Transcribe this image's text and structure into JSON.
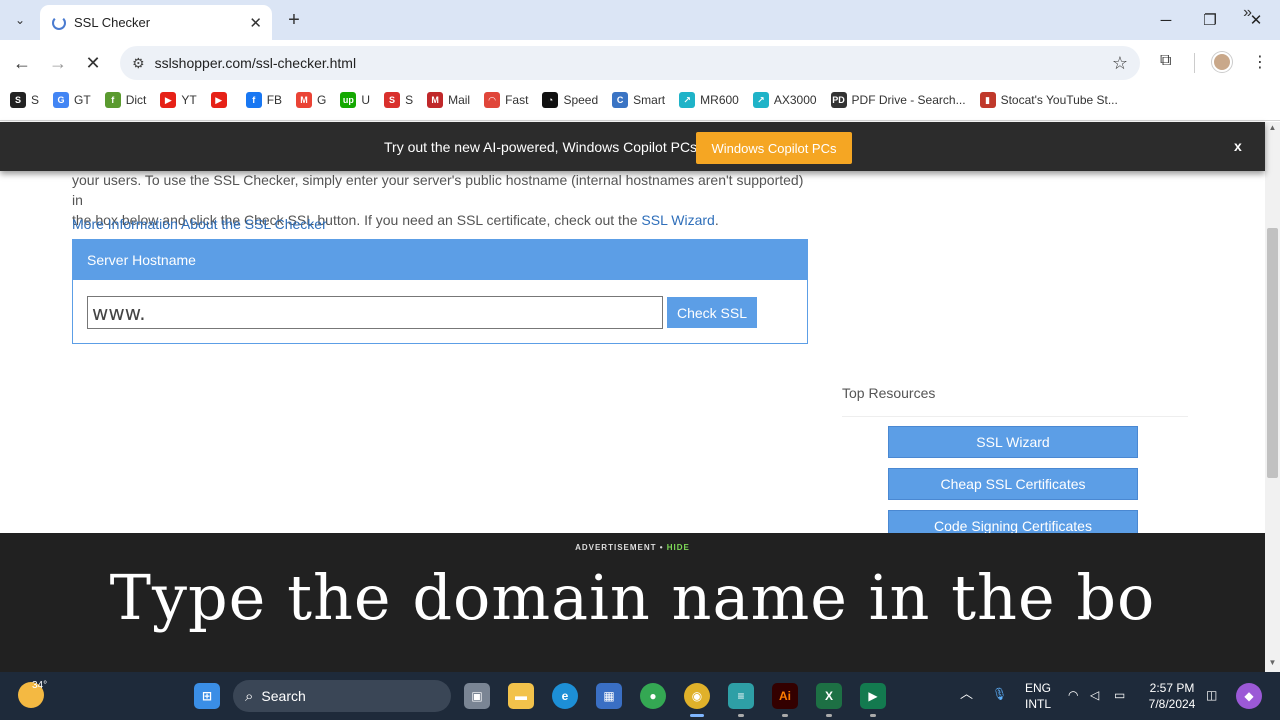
{
  "browser": {
    "tab_title": "SSL Checker",
    "url": "sslshopper.com/ssl-checker.html",
    "new_tab_glyph": "+",
    "close_glyph": "✕"
  },
  "bookmarks": [
    {
      "label": "S",
      "color": "#222222",
      "icon": "S"
    },
    {
      "label": "GT",
      "color": "#4285f4",
      "icon": "G"
    },
    {
      "label": "Dict",
      "color": "#5a9a2f",
      "icon": "f"
    },
    {
      "label": "YT",
      "color": "#e62117",
      "icon": "▶"
    },
    {
      "label": "",
      "color": "#e62117",
      "icon": "▶"
    },
    {
      "label": "FB",
      "color": "#1877f2",
      "icon": "f"
    },
    {
      "label": "G",
      "color": "#ea4335",
      "icon": "M"
    },
    {
      "label": "U",
      "color": "#14a800",
      "icon": "up"
    },
    {
      "label": "S",
      "color": "#d9302c",
      "icon": "S"
    },
    {
      "label": "Mail",
      "color": "#c0282a",
      "icon": "M"
    },
    {
      "label": "Fast",
      "color": "#e0463a",
      "icon": "◠"
    },
    {
      "label": "Speed",
      "color": "#111111",
      "icon": "◔"
    },
    {
      "label": "Smart",
      "color": "#3a74c4",
      "icon": "C"
    },
    {
      "label": "MR600",
      "color": "#1fb3c8",
      "icon": "↗"
    },
    {
      "label": "AX3000",
      "color": "#1fb3c8",
      "icon": "↗"
    },
    {
      "label": "PDF Drive - Search...",
      "color": "#333333",
      "icon": "PD"
    },
    {
      "label": "Stocat's YouTube St...",
      "color": "#c0392b",
      "icon": "▮"
    }
  ],
  "promo": {
    "text": "Try out the new AI-powered, Windows Copilot PCs",
    "button": "Windows Copilot PCs",
    "close": "x"
  },
  "page": {
    "intro_line1": "your users. To use the SSL Checker, simply enter your server's public hostname (internal hostnames aren't supported) in",
    "intro_line2": "the box below and click the Check SSL button. If you need an SSL certificate, check out the ",
    "intro_link": "SSL Wizard",
    "intro_end": ".",
    "more_info": "More Information About the SSL Checker",
    "panel_title": "Server Hostname",
    "input_value": "www.",
    "check_button": "Check SSL",
    "resources_title": "Top Resources",
    "resources": [
      "SSL Wizard",
      "Cheap SSL Certificates",
      "Code Signing Certificates"
    ]
  },
  "overlay": {
    "ad_label": "ADVERTISEMENT",
    "ad_sep": " • ",
    "ad_hide": "HIDE",
    "caption": "Type the domain name in the bo"
  },
  "taskbar": {
    "temperature": "34°",
    "search": "Search",
    "lang1": "ENG",
    "lang2": "INTL",
    "time": "2:57 PM",
    "date": "7/8/2024",
    "excel_letter": "X",
    "ai_letter": "Ai"
  }
}
